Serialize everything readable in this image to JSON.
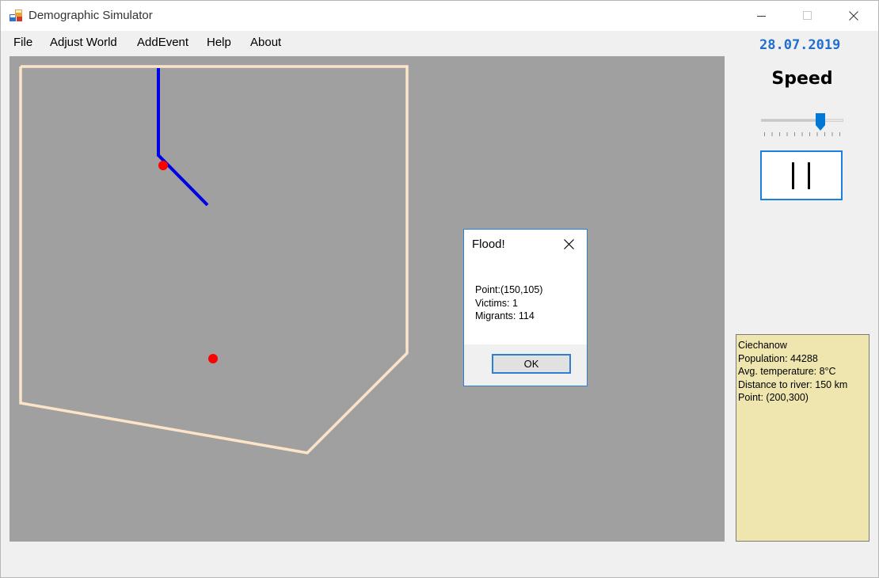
{
  "window": {
    "title": "Demographic Simulator"
  },
  "menu": {
    "file": "File",
    "adjust_world": "Adjust World",
    "add_event": "AddEvent",
    "help": "Help",
    "about": "About"
  },
  "date": "28.07.2019",
  "speed": {
    "label": "Speed",
    "value_fraction": 0.72,
    "tick_count": 11
  },
  "pause_icon": "pause-icon",
  "info": {
    "name": "Ciechanow",
    "population": "Population: 44288",
    "temperature": "Avg. temperature: 8°C",
    "river_distance": "Distance to river: 150 km",
    "point": "Point: (200,300)"
  },
  "dialog": {
    "title": "Flood!",
    "point": "Point:(150,105)",
    "victims": "Victims: 1",
    "migrants": "Migrants: 114",
    "ok_label": "OK"
  },
  "colors": {
    "map_bg": "#a0a0a0",
    "border": "#fbe4c8",
    "river": "#0000e6",
    "city": "#ff0000",
    "accent": "#1e6fd0"
  }
}
